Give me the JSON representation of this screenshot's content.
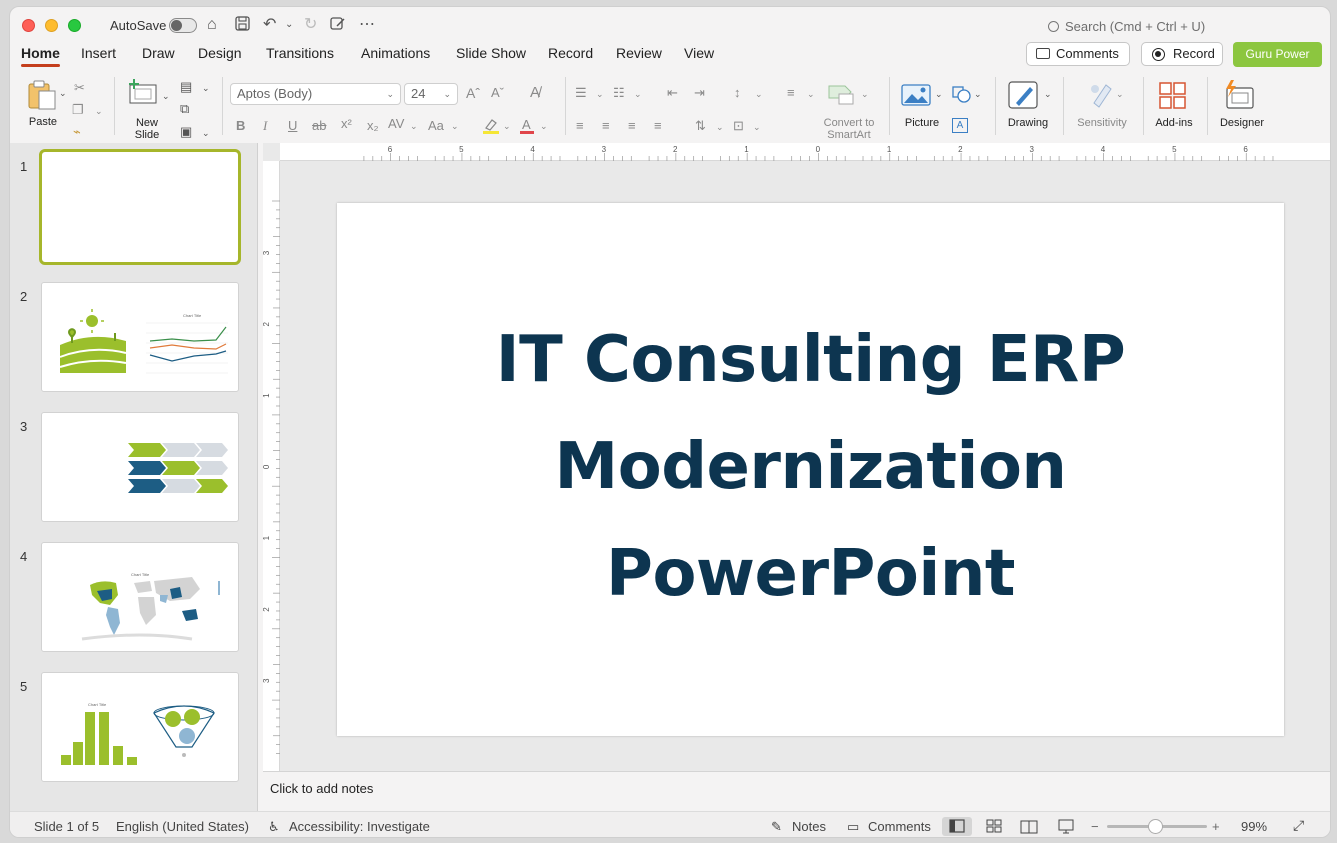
{
  "titlebar": {
    "autosave_label": "AutoSave",
    "search_placeholder": "Search (Cmd + Ctrl + U)"
  },
  "tabs": [
    "Home",
    "Insert",
    "Draw",
    "Design",
    "Transitions",
    "Animations",
    "Slide Show",
    "Record",
    "Review",
    "View"
  ],
  "active_tab": "Home",
  "header_buttons": {
    "comments": "Comments",
    "record": "Record",
    "addin": "Guru Power"
  },
  "ribbon": {
    "paste": "Paste",
    "new_slide_line1": "New",
    "new_slide_line2": "Slide",
    "font_name": "Aptos (Body)",
    "font_size": "24",
    "convert_line1": "Convert to",
    "convert_line2": "SmartArt",
    "picture": "Picture",
    "drawing": "Drawing",
    "sensitivity": "Sensitivity",
    "addins": "Add-ins",
    "designer": "Designer"
  },
  "ruler": {
    "h_ticks": [
      "6",
      "5",
      "4",
      "3",
      "2",
      "1",
      "0",
      "1",
      "2",
      "3",
      "4",
      "5",
      "6"
    ],
    "v_ticks": [
      "3",
      "2",
      "1",
      "0",
      "1",
      "2",
      "3"
    ]
  },
  "thumbnails": [
    {
      "number": "1",
      "chart_title": ""
    },
    {
      "number": "2",
      "chart_title": "Chart Title"
    },
    {
      "number": "3",
      "chart_title": ""
    },
    {
      "number": "4",
      "chart_title": "Chart Title"
    },
    {
      "number": "5",
      "chart_title": "Chart Title"
    }
  ],
  "slide": {
    "title_lines": [
      "IT Consulting ERP",
      "Modernization",
      "PowerPoint"
    ]
  },
  "notes_placeholder": "Click to add notes",
  "status": {
    "slide_counter": "Slide 1 of 5",
    "language": "English (United States)",
    "accessibility": "Accessibility: Investigate",
    "notes": "Notes",
    "comments": "Comments",
    "zoom": "99%"
  },
  "colors": {
    "accent_tab": "#c43e1c",
    "brand_green": "#8cc63f",
    "title_navy": "#0d3550",
    "selected_thumb": "#a6b62b"
  }
}
